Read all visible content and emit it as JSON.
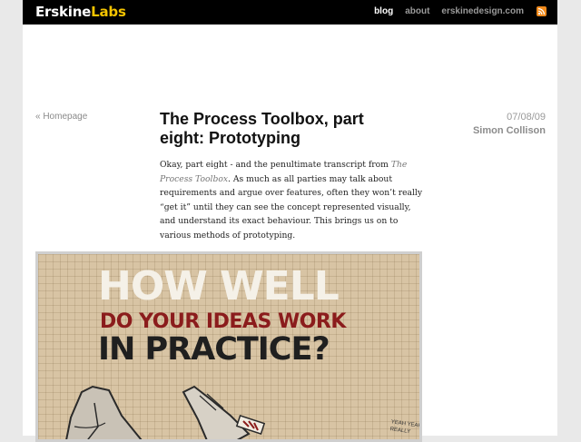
{
  "site": {
    "logo_primary": "Erskine",
    "logo_accent": "Labs"
  },
  "nav": {
    "items": [
      {
        "label": "blog",
        "active": true
      },
      {
        "label": "about",
        "active": false
      },
      {
        "label": "erskinedesign.com",
        "active": false
      }
    ],
    "rss_icon": "rss-feed-icon"
  },
  "post": {
    "back_link": "« Homepage",
    "title": "The Process Toolbox, part eight: Prototyping",
    "date": "07/08/09",
    "author": "Simon Collison",
    "intro_before": "Okay, part eight - and the penultimate transcript from ",
    "intro_link": "The Process Toolbox",
    "intro_after": ". As much as all parties may talk about requirements and argue over features, often they won’t really “get it” until they can see the concept represented visually, and understand its exact behaviour. This brings us on to various methods of prototyping."
  },
  "poster": {
    "line1": "HOW WELL",
    "line2": "DO YOUR IDEAS WORK",
    "line3": "IN PRACTICE?",
    "scribble_line1": "YEAH YEAH IT",
    "scribble_line2": "REALLY"
  },
  "colors": {
    "topbar": "#000000",
    "logo_accent": "#f5c400",
    "rss": "#f08a1c",
    "poster_red": "#8b1c1c",
    "poster_bg": "#d8c4a4"
  }
}
